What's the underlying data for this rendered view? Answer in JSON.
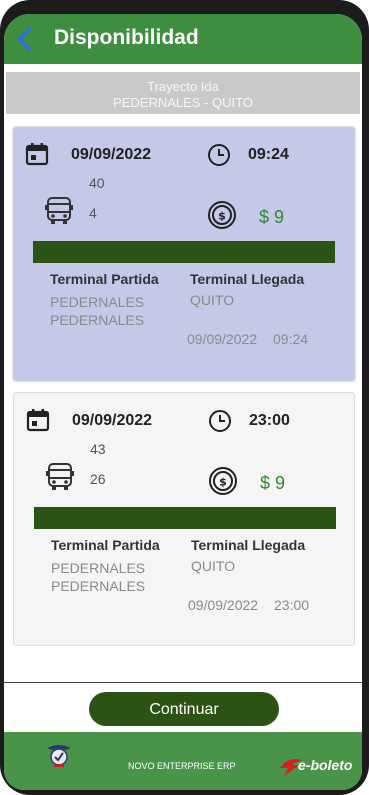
{
  "header": {
    "title": "Disponibilidad"
  },
  "route": {
    "label": "Trayecto Ida",
    "path": "PEDERNALES - QUITO"
  },
  "trips": [
    {
      "date": "09/09/2022",
      "time": "09:24",
      "seats_top": "40",
      "seats_bottom": "4",
      "price": "$ 9",
      "origin_label": "Terminal Partida",
      "origin_city": "PEDERNALES",
      "origin_terminal": "PEDERNALES",
      "dest_label": "Terminal Llegada",
      "dest_city": "QUITO",
      "arrival_date": "09/09/2022",
      "arrival_time": "09:24"
    },
    {
      "date": "09/09/2022",
      "time": "23:00",
      "seats_top": "43",
      "seats_bottom": "26",
      "price": "$ 9",
      "origin_label": "Terminal Partida",
      "origin_city": "PEDERNALES",
      "origin_terminal": "PEDERNALES",
      "dest_label": "Terminal Llegada",
      "dest_city": "QUITO",
      "arrival_date": "09/09/2022",
      "arrival_time": "23:00"
    }
  ],
  "actions": {
    "continue_label": "Continuar"
  },
  "footer": {
    "company": "NOVO ENTERPRISE ERP",
    "brand": "e-boleto"
  },
  "colors": {
    "header_green": "#3f8e3f",
    "dark_green": "#2b5414",
    "selected_card": "#c5c9e8",
    "back_blue": "#2f6fd6"
  }
}
